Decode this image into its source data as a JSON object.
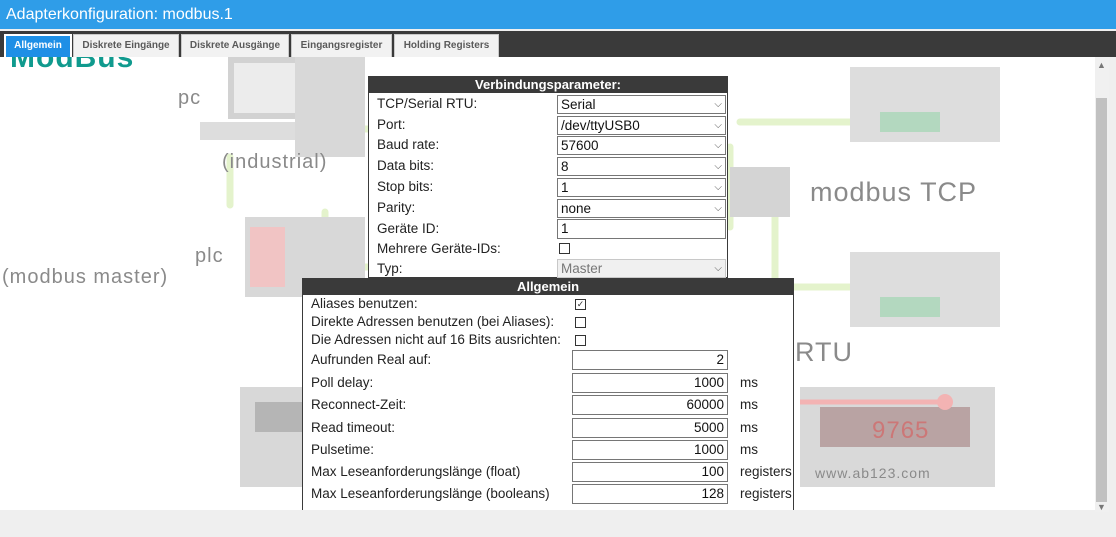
{
  "window": {
    "title": "Adapterkonfiguration: modbus.1"
  },
  "tabs": [
    {
      "label": "Allgemein"
    },
    {
      "label": "Diskrete Eingänge"
    },
    {
      "label": "Diskrete Ausgänge"
    },
    {
      "label": "Eingangsregister"
    },
    {
      "label": "Holding Registers"
    }
  ],
  "background": {
    "logo": "ModBus",
    "pc": "pc",
    "industrial": "(industrial)",
    "plc": "plc",
    "modbus_master": "(modbus master)",
    "modbus_tcp": "modbus TCP",
    "rtu": "RTU",
    "display_value": "9765",
    "website": "www.ab123.com"
  },
  "connection": {
    "title": "Verbindungsparameter:",
    "rows": [
      {
        "label": "TCP/Serial RTU:",
        "value": "Serial"
      },
      {
        "label": "Port:",
        "value": "/dev/ttyUSB0"
      },
      {
        "label": "Baud rate:",
        "value": "57600"
      },
      {
        "label": "Data bits:",
        "value": "8"
      },
      {
        "label": "Stop bits:",
        "value": "1"
      },
      {
        "label": "Parity:",
        "value": "none"
      },
      {
        "label": "Geräte ID:",
        "value": "1"
      },
      {
        "label": "Mehrere Geräte-IDs:",
        "checked": false
      },
      {
        "label": "Typ:",
        "value": "Master"
      }
    ]
  },
  "general": {
    "title": "Allgemein",
    "checkboxes": [
      {
        "label": "Aliases benutzen:",
        "checked": true,
        "mark": "✓"
      },
      {
        "label": "Direkte Adressen benutzen (bei Aliases):",
        "checked": false
      },
      {
        "label": "Die Adressen nicht auf 16 Bits ausrichten:",
        "checked": false
      }
    ],
    "fields": [
      {
        "label": "Aufrunden Real auf:",
        "value": "2",
        "unit": ""
      },
      {
        "label": "Poll delay:",
        "value": "1000",
        "unit": "ms"
      },
      {
        "label": "Reconnect-Zeit:",
        "value": "60000",
        "unit": "ms"
      },
      {
        "label": "Read timeout:",
        "value": "5000",
        "unit": "ms"
      },
      {
        "label": "Pulsetime:",
        "value": "1000",
        "unit": "ms"
      },
      {
        "label": "Max Leseanforderungslänge (float)",
        "value": "100",
        "unit": "registers"
      },
      {
        "label": "Max Leseanforderungslänge (booleans)",
        "value": "128",
        "unit": "registers"
      }
    ]
  }
}
